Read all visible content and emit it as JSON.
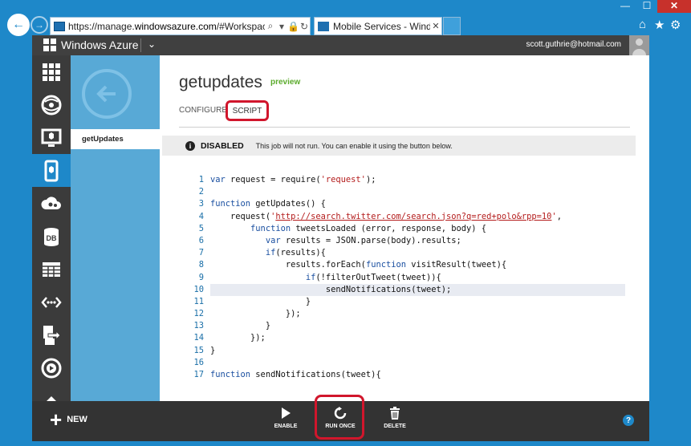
{
  "browser": {
    "address_url_prefix": "https://manage.",
    "address_url_domain": "windowsazure.com",
    "address_url_rest": "/#Workspaces/MobileS",
    "tab_title": "Mobile Services - Windows ...",
    "close_glyph": "✕",
    "back_glyph": "←",
    "forward_glyph": "→",
    "search_glyph": "⌕",
    "dropdown_glyph": "▾",
    "lock_glyph": "🔒",
    "refresh_glyph": "↻",
    "home_glyph": "⌂",
    "star_glyph": "★",
    "gear_glyph": "⚙",
    "min_glyph": "—",
    "max_glyph": "☐",
    "winclose_glyph": "✕"
  },
  "header": {
    "brand": "Windows Azure",
    "chevron": "⌄",
    "user_email": "scott.guthrie@hotmail.com"
  },
  "leftnav": {
    "icons": [
      "all-items-icon",
      "web-sites-icon",
      "virtual-machines-icon",
      "mobile-services-icon",
      "cloud-services-icon",
      "sql-databases-icon",
      "storage-icon",
      "networks-icon",
      "service-bus-icon",
      "media-services-icon",
      "more-icon"
    ],
    "selected": "mobile-services-icon",
    "db_label": "DB"
  },
  "subnav": {
    "item": "getUpdates"
  },
  "page": {
    "title": "getupdates",
    "preview": "preview",
    "tabs": {
      "configure": "CONFIGURE",
      "script": "SCRIPT"
    },
    "status": {
      "icon": "i",
      "label": "DISABLED",
      "message": "This job will not run. You can enable it using the button below."
    }
  },
  "code": {
    "lines": [
      "1",
      "2",
      "3",
      "4",
      "5",
      "6",
      "7",
      "8",
      "9",
      "10",
      "11",
      "12",
      "13",
      "14",
      "15",
      "16",
      "17"
    ],
    "highlight_line": "10"
  },
  "bottombar": {
    "new": "NEW",
    "plus": "+",
    "enable": "ENABLE",
    "run_once": "RUN ONCE",
    "delete": "DELETE",
    "help": "?"
  },
  "colors": {
    "accent": "#1e88c9",
    "annotation_red": "#d1162c",
    "preview_green": "#5bab2c"
  }
}
